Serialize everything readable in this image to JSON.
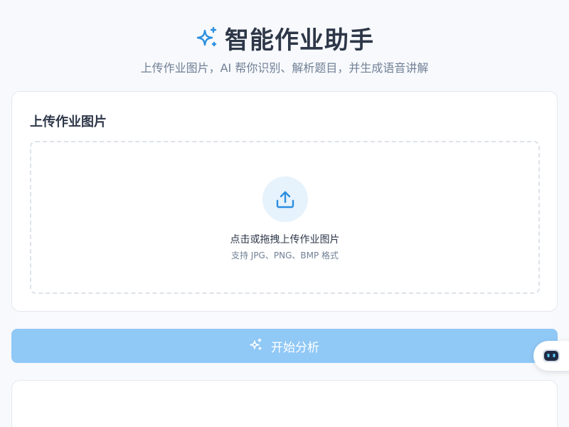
{
  "header": {
    "title": "智能作业助手",
    "subtitle": "上传作业图片，AI 帮你识别、解析题目，并生成语音讲解",
    "icon": "sparkles-icon"
  },
  "upload": {
    "card_title": "上传作业图片",
    "drop_text": "点击或拖拽上传作业图片",
    "drop_hint": "支持 JPG、PNG、BMP 格式",
    "icon": "upload-icon"
  },
  "actions": {
    "analyze_label": "开始分析",
    "analyze_icon": "sparkles-icon",
    "analyze_enabled": false
  },
  "assistant": {
    "icon": "robot-icon"
  },
  "colors": {
    "accent": "#2b8fe0",
    "button_disabled": "#90c8f6",
    "background": "#f7f9fc",
    "text_primary": "#2d3748",
    "text_secondary": "#718096"
  }
}
